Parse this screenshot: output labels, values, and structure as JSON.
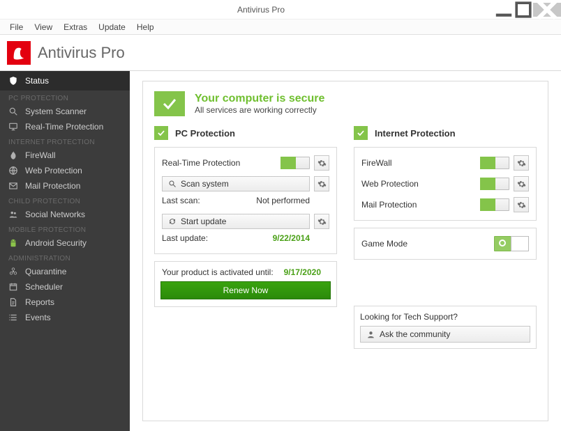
{
  "window": {
    "title": "Antivirus Pro"
  },
  "menu": {
    "file": "File",
    "view": "View",
    "extras": "Extras",
    "update": "Update",
    "help": "Help"
  },
  "brand": {
    "name": "Antivirus Pro"
  },
  "sidebar": {
    "status": "Status",
    "sections": {
      "pc": {
        "label": "PC PROTECTION",
        "scanner": "System Scanner",
        "realtime": "Real-Time Protection"
      },
      "internet": {
        "label": "INTERNET PROTECTION",
        "firewall": "FireWall",
        "web": "Web Protection",
        "mail": "Mail Protection"
      },
      "child": {
        "label": "CHILD PROTECTION",
        "social": "Social Networks"
      },
      "mobile": {
        "label": "MOBILE PROTECTION",
        "android": "Android Security"
      },
      "admin": {
        "label": "ADMINISTRATION",
        "quarantine": "Quarantine",
        "scheduler": "Scheduler",
        "reports": "Reports",
        "events": "Events"
      }
    }
  },
  "status": {
    "headline": "Your computer is secure",
    "subline": "All services are working correctly"
  },
  "pc": {
    "title": "PC Protection",
    "realtime_label": "Real-Time Protection",
    "scan_btn": "Scan system",
    "last_scan_label": "Last scan:",
    "last_scan_value": "Not performed",
    "update_btn": "Start update",
    "last_update_label": "Last update:",
    "last_update_value": "9/22/2014"
  },
  "internet": {
    "title": "Internet Protection",
    "rows": {
      "firewall": "FireWall",
      "web": "Web Protection",
      "mail": "Mail Protection"
    }
  },
  "game_mode": {
    "label": "Game Mode"
  },
  "license": {
    "label": "Your product is activated until:",
    "date": "9/17/2020",
    "renew": "Renew Now"
  },
  "support": {
    "question": "Looking for Tech Support?",
    "button": "Ask the community"
  }
}
